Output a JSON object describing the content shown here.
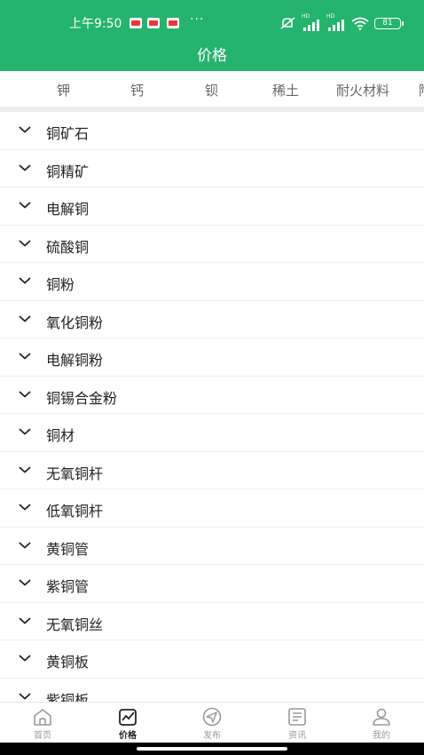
{
  "status": {
    "time": "上午9:50",
    "dots": "···",
    "battery": "81",
    "hd1": "HD",
    "hd2": "HD"
  },
  "header": {
    "title": "价格"
  },
  "tabs": [
    "钾",
    "钙",
    "钡",
    "稀土",
    "耐火材料",
    "陶"
  ],
  "items": [
    "铜矿石",
    "铜精矿",
    "电解铜",
    "硫酸铜",
    "铜粉",
    "氧化铜粉",
    "电解铜粉",
    "铜锡合金粉",
    "铜材",
    "无氧铜杆",
    "低氧铜杆",
    "黄铜管",
    "紫铜管",
    "无氧铜丝",
    "黄铜板",
    "紫铜板"
  ],
  "tabbar": [
    {
      "label": "首页",
      "icon": "home-icon"
    },
    {
      "label": "价格",
      "icon": "price-chart-icon",
      "active": true
    },
    {
      "label": "发布",
      "icon": "send-icon"
    },
    {
      "label": "资讯",
      "icon": "news-icon"
    },
    {
      "label": "我的",
      "icon": "user-icon"
    }
  ],
  "colors": {
    "brand": "#25b46e",
    "text": "#222222",
    "muted": "#999999"
  }
}
